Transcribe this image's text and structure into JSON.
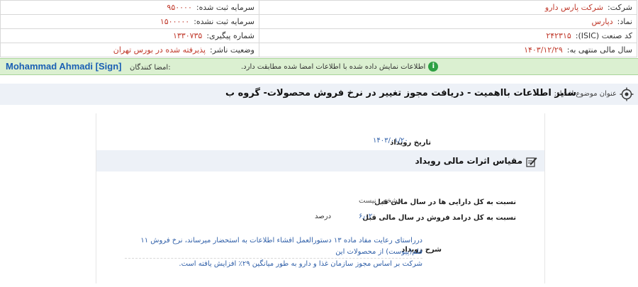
{
  "info": {
    "company_label": "شرکت:",
    "company_value": "شرکت پارس دارو",
    "registered_capital_label": "سرمایه ثبت شده:",
    "registered_capital_value": "۹۵۰۰۰۰",
    "symbol_label": "نماد:",
    "symbol_value": "دپارس",
    "unregistered_capital_label": "سرمایه ثبت نشده:",
    "unregistered_capital_value": "۱۵۰۰۰۰۰",
    "isic_label": "کد صنعت (ISIC):",
    "isic_value": "۲۴۲۳۱۵",
    "tracking_label": "شماره پیگیری:",
    "tracking_value": "۱۳۳۰۷۳۵",
    "fiscal_year_label": "سال مالی منتهی به:",
    "fiscal_year_value": "۱۴۰۳/۱۲/۲۹",
    "publisher_status_label": "وضعیت ناشر:",
    "publisher_status_value": "پذیرفته شده در بورس تهران"
  },
  "signature": {
    "label": "امضا کنندگان:",
    "name": "Mohammad Ahmadi [Sign]",
    "message": "اطلاعات نمایش داده شده با اطلاعات امضا شده مطابقت دارد."
  },
  "subject": {
    "label": "عنوان موضوع افشاء:",
    "text": "سایر اطلاعات بااهمیت - دریافت مجوز تغییر در نرخ فروش محصولات- گروه ب"
  },
  "event": {
    "date_label": "تاریخ رویداد",
    "date_value": "۱۴۰۳/۰۱/۲۰",
    "section_title": "مقیاس اثرات مالی رویداد",
    "assets_ratio_label": "نسبت به کل دارایی ها در سال مالی قبل",
    "assets_ratio_value": "مشخص نیست",
    "sales_ratio_label": "نسبت به کل درامد فروش در سال مالی قبل",
    "sales_ratio_value": "۶٫۰۲",
    "sales_ratio_unit": "درصد",
    "description_label": "شرح رویداد",
    "description_line1": "درراستای رعایت مفاد ماده ۱۳ دستورالعمل افشاء اطلاعات به استحضار میرساند، نرخ فروش ۱۱ قلم(پیوست) از محصولات این",
    "description_line2": "شرکت بر اساس مجوز سازمان غذا و دارو به طور میانگین ۲۹٪ افزایش یافته است."
  },
  "icons": {
    "info": "info-icon",
    "target": "target-icon",
    "edit": "edit-icon"
  },
  "colors": {
    "value_text": "#c0392b",
    "signature_bar": "#dbf0d1",
    "signature_name": "#1a5fb4",
    "section_bg": "#edf1f7",
    "blue_value": "#2f5fa8"
  }
}
